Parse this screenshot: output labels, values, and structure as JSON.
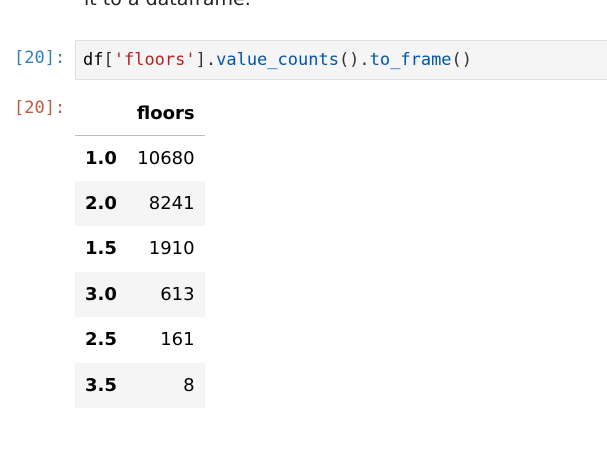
{
  "previous_text": "it to a dataframe.",
  "input_cell": {
    "prompt": "[20]:",
    "code": {
      "var": "df",
      "open_bracket": "[",
      "key": "'floors'",
      "close_bracket_dot": "].",
      "method1": "value_counts",
      "call1": "().",
      "method2": "to_frame",
      "call2": "()"
    }
  },
  "output_cell": {
    "prompt": "[20]:",
    "table": {
      "index_header": "",
      "column_header": "floors",
      "rows": [
        {
          "index": "1.0",
          "value": "10680"
        },
        {
          "index": "2.0",
          "value": "8241"
        },
        {
          "index": "1.5",
          "value": "1910"
        },
        {
          "index": "3.0",
          "value": "613"
        },
        {
          "index": "2.5",
          "value": "161"
        },
        {
          "index": "3.5",
          "value": "8"
        }
      ]
    }
  },
  "colors": {
    "input_prompt": "#307fc1",
    "output_prompt": "#bf5b3d",
    "string": "#ba2121",
    "function": "#0055aa",
    "cell_background": "#f5f5f5"
  }
}
